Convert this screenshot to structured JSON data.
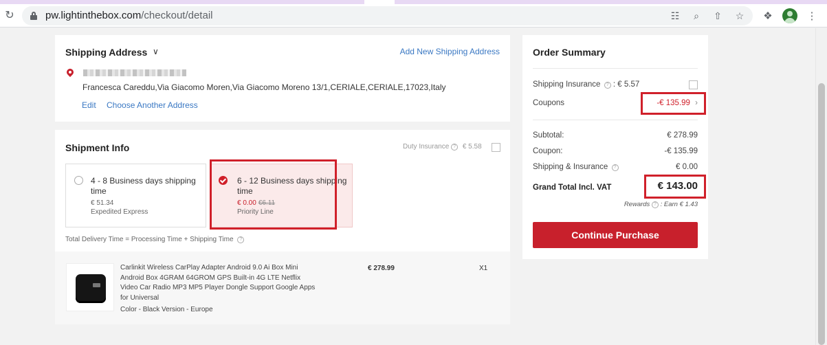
{
  "browser": {
    "url_host": "pw.lightinthebox.com",
    "url_path": "/checkout/detail"
  },
  "shipping_address": {
    "title": "Shipping Address",
    "add_link": "Add New Shipping Address",
    "address_line": "Francesca Careddu,Via Giacomo Moren,Via Giacomo Moreno 13/1,CERIALE,CERIALE,17023,Italy",
    "edit": "Edit",
    "choose_another": "Choose Another Address"
  },
  "shipment": {
    "title": "Shipment Info",
    "duty_label": "Duty Insurance",
    "duty_price": "€ 5.58",
    "options": [
      {
        "days": "4 - 8 Business days shipping time",
        "price": "€ 51.34",
        "method": "Expedited Express",
        "selected": false
      },
      {
        "days": "6 - 12 Business days shipping time",
        "price": "€ 0.00",
        "old_price": "€6.11",
        "method": "Priority Line",
        "selected": true
      }
    ],
    "delivery_note": "Total Delivery Time = Processing Time + Shipping Time"
  },
  "product": {
    "title": "Carlinkit Wireless CarPlay Adapter Android 9.0 Ai Box Mini Android Box 4GRAM 64GROM GPS Built-in 4G LTE Netflix Video Car Radio MP3 MP5 Player Dongle Support Google Apps for Universal",
    "variant": "Color - Black  Version - Europe",
    "price": "€ 278.99",
    "qty": "X1"
  },
  "summary": {
    "title": "Order Summary",
    "shipping_insurance_label": "Shipping Insurance",
    "shipping_insurance_value": ": € 5.57",
    "coupons_label": "Coupons",
    "coupons_value": "-€ 135.99",
    "subtotal_label": "Subtotal:",
    "subtotal_value": "€ 278.99",
    "coupon_label": "Coupon:",
    "coupon_value": "-€ 135.99",
    "ship_ins_label": "Shipping & Insurance",
    "ship_ins_value": "€ 0.00",
    "grand_label": "Grand Total Incl. VAT",
    "grand_value": "€ 143.00",
    "rewards_label": "Rewards",
    "rewards_value": ": Earn € 1.43",
    "continue": "Continue Purchase"
  },
  "colors": {
    "accent_red": "#c8202c",
    "link_blue": "#3a78c3"
  }
}
